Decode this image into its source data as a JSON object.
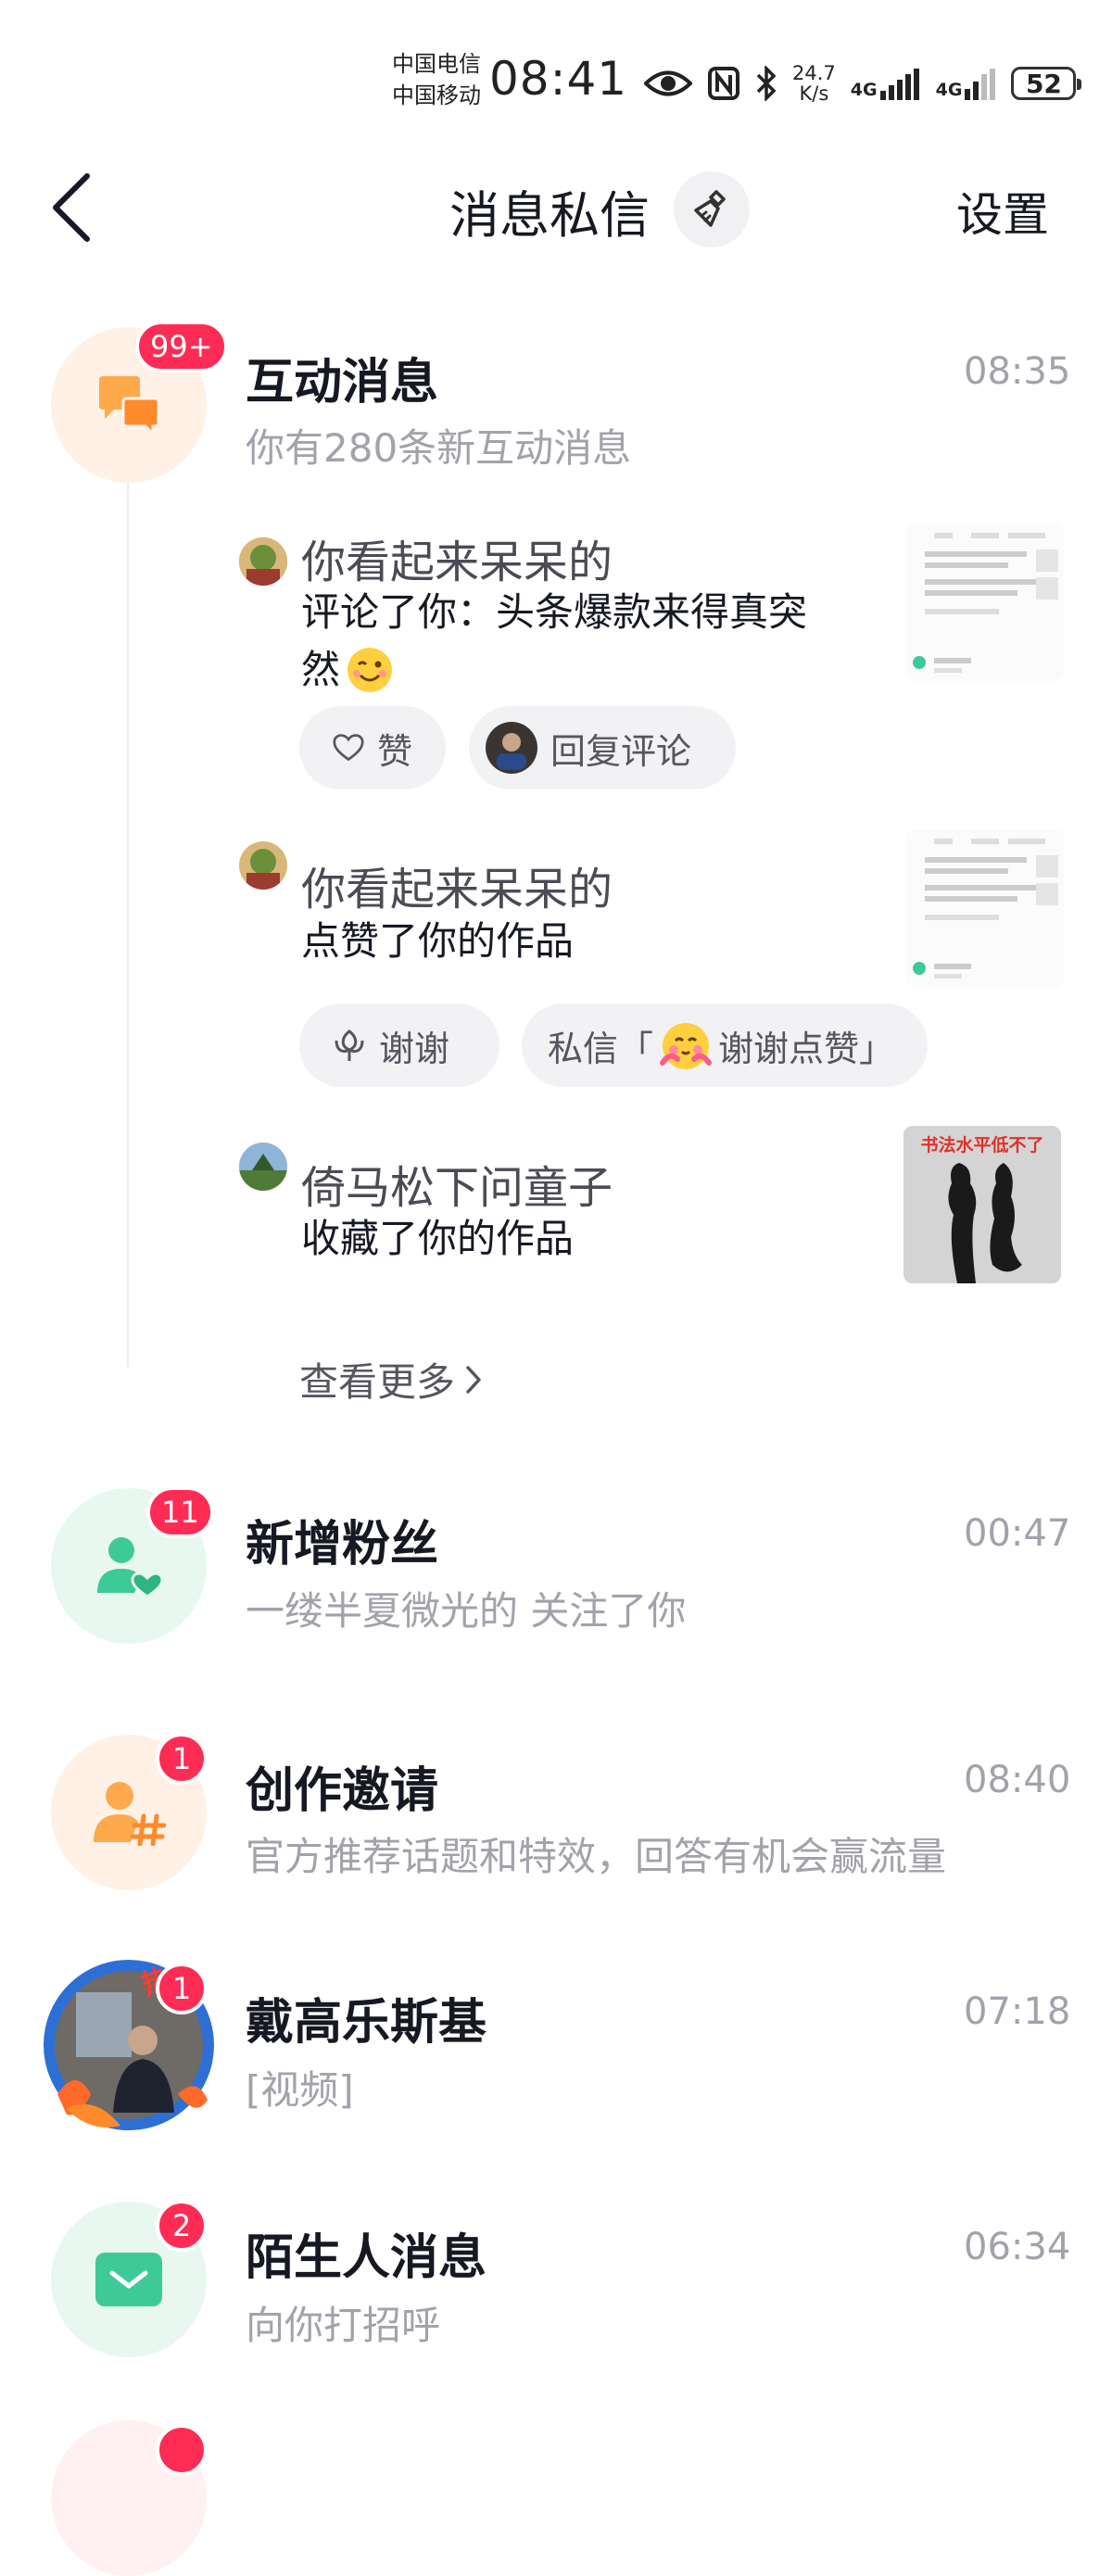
{
  "status_bar": {
    "carrier1": "中国电信",
    "carrier2": "中国移动",
    "time": "08:41",
    "speed_value": "24.7",
    "speed_unit": "K/s",
    "net1": "4G",
    "net2": "4G",
    "battery": "52"
  },
  "header": {
    "title": "消息私信",
    "settings_label": "设置",
    "back_icon": "chevron-left-icon",
    "clean_icon": "broom-icon"
  },
  "interactions": {
    "title": "互动消息",
    "subtitle": "你有280条新互动消息",
    "time": "08:35",
    "badge": "99+",
    "items": [
      {
        "user": "你看起来呆呆的",
        "action_line1": "评论了你：头条爆款来得真突",
        "action_line2": "然",
        "like_label": "赞",
        "reply_label": "回复评论"
      },
      {
        "user": "你看起来呆呆的",
        "action": "点赞了你的作品",
        "thanks_label": "谢谢",
        "dm_prefix": "私信「",
        "dm_text": "谢谢点赞」"
      },
      {
        "user": "倚马松下问童子",
        "action": "收藏了你的作品",
        "thumb_caption": "书法水平低不了"
      }
    ],
    "see_more": "查看更多"
  },
  "rows": [
    {
      "title": "新增粉丝",
      "subtitle": "一缕半夏微光的 关注了你",
      "time": "00:47",
      "badge": "11"
    },
    {
      "title": "创作邀请",
      "subtitle": "官方推荐话题和特效，回答有机会赢流量",
      "time": "08:40",
      "badge": "1"
    },
    {
      "title": "戴高乐斯基",
      "subtitle": "[视频]",
      "time": "07:18",
      "badge": "1",
      "avatar_tag": "热"
    },
    {
      "title": "陌生人消息",
      "subtitle": "向你打招呼",
      "time": "06:34",
      "badge": "2"
    }
  ],
  "colors": {
    "accent_red": "#fe2c55",
    "orange_bg": "#fff1e6",
    "orange_icon": "#ffa94d",
    "green_bg": "#e8f8f1",
    "green_icon": "#3ec999"
  }
}
